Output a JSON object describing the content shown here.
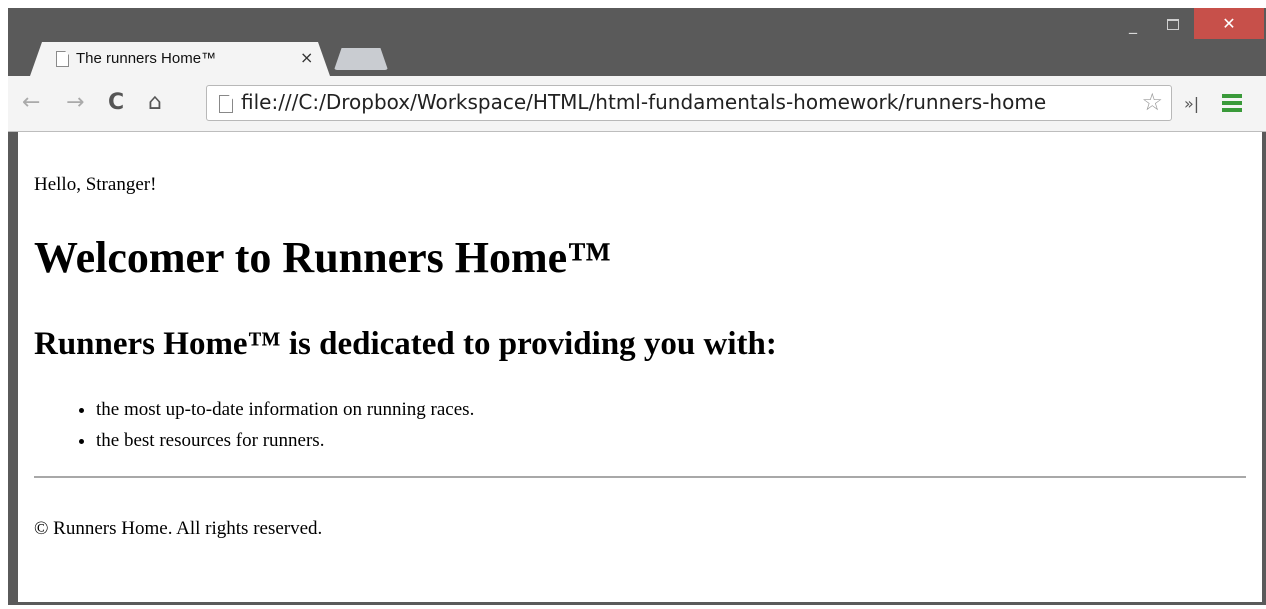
{
  "window": {
    "minimize_glyph": "_",
    "close_glyph": "✕"
  },
  "tab": {
    "title": "The runners Home™",
    "close_glyph": "×",
    "icon": "page-icon"
  },
  "toolbar": {
    "back_glyph": "←",
    "forward_glyph": "→",
    "reload_glyph": "C",
    "home_glyph": "⌂",
    "url": "file:///C:/Dropbox/Workspace/HTML/html-fundamentals-homework/runners-home",
    "bookmark_glyph": "☆",
    "overflow_glyph": "»|"
  },
  "page": {
    "greeting": "Hello, Stranger!",
    "heading": "Welcomer to Runners Home™",
    "subheading": "Runners Home™ is dedicated to providing you with:",
    "list": [
      "the most up-to-date information on running races.",
      "the best resources for runners."
    ],
    "footer": "© Runners Home. All rights reserved."
  },
  "colors": {
    "frame": "#5a5a5a",
    "close_button": "#c7504a",
    "menu_icon": "#3a9a3a"
  }
}
